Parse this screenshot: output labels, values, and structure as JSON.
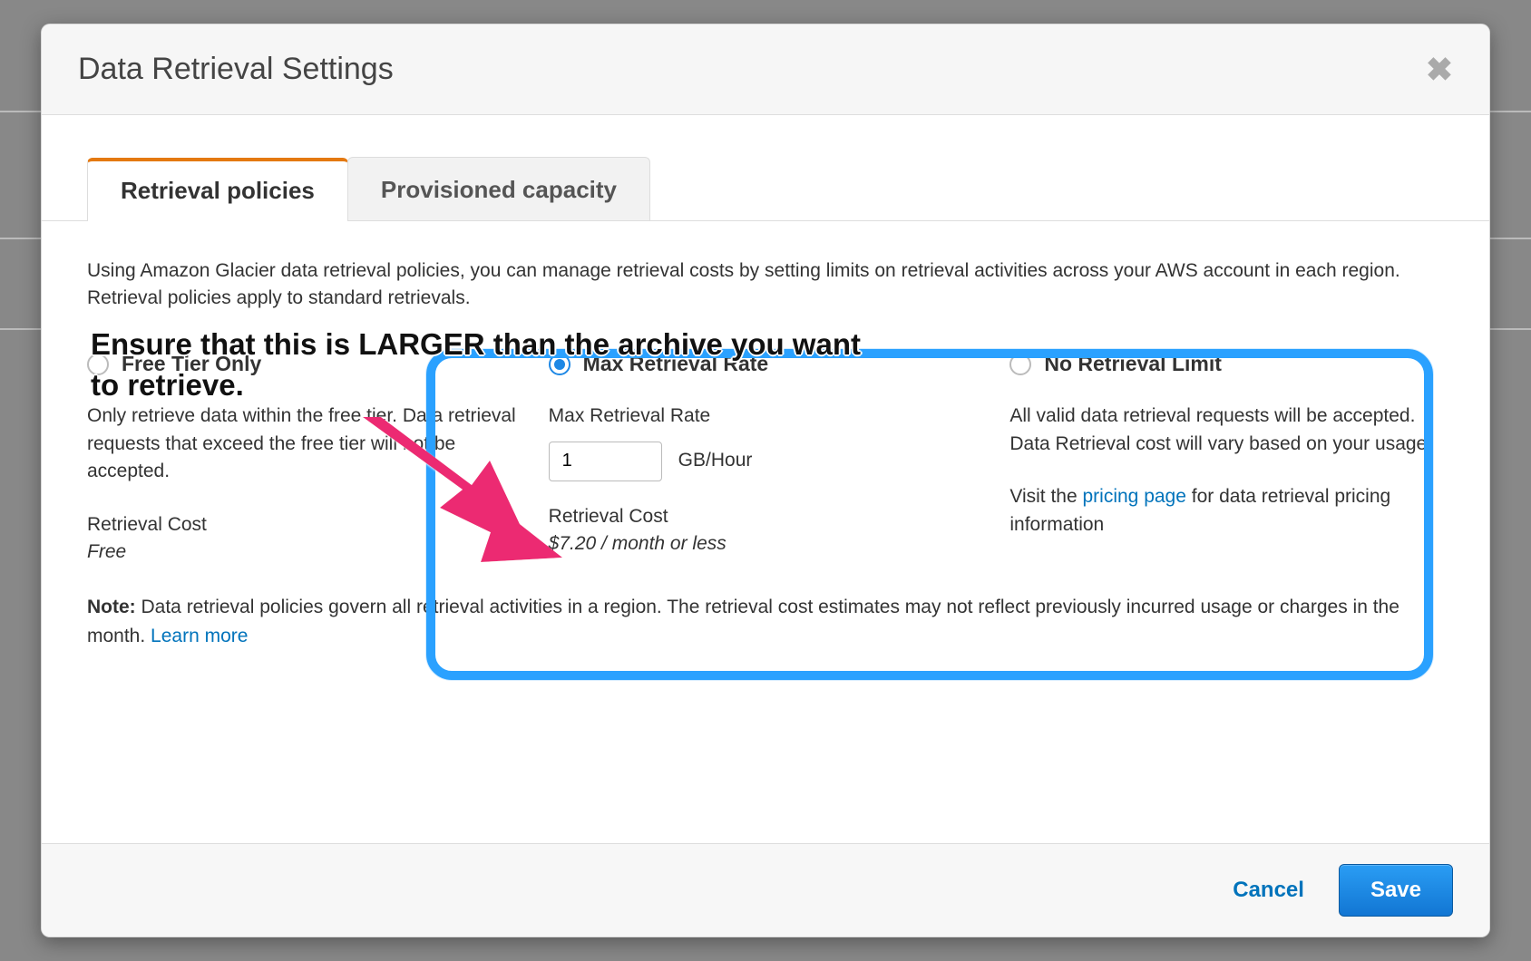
{
  "modal": {
    "title": "Data Retrieval Settings",
    "close_glyph": "✖"
  },
  "tabs": {
    "retrieval_policies": "Retrieval policies",
    "provisioned_capacity": "Provisioned capacity"
  },
  "intro": "Using Amazon Glacier data retrieval policies, you can manage retrieval costs by setting limits on retrieval activities across your AWS account in each region. Retrieval policies apply to standard retrievals.",
  "options": {
    "free_tier": {
      "label": "Free Tier Only",
      "desc": "Only retrieve data within the free tier. Data retrieval requests that exceed the free tier will not be accepted.",
      "cost_label": "Retrieval Cost",
      "cost_value": "Free"
    },
    "max_rate": {
      "label": "Max Retrieval Rate",
      "sub_label": "Max Retrieval Rate",
      "rate_value": "1",
      "unit": "GB/Hour",
      "cost_label": "Retrieval Cost",
      "cost_value": "$7.20 / month or less"
    },
    "no_limit": {
      "label": "No Retrieval Limit",
      "desc": "All valid data retrieval requests will be accepted. Data Retrieval cost will vary based on your usage.",
      "visit_prefix": "Visit the ",
      "pricing_link": "pricing page",
      "visit_suffix": " for data retrieval pricing information"
    }
  },
  "note": {
    "prefix": "Note: ",
    "body": "Data retrieval policies govern all retrieval activities in a region. The retrieval cost estimates may not reflect previously incurred usage or charges in the month. ",
    "learn_more": "Learn more"
  },
  "footer": {
    "cancel": "Cancel",
    "save": "Save"
  },
  "annotation": {
    "text": "Ensure that this is LARGER than the archive you want to retrieve."
  },
  "colors": {
    "accent_orange": "#e47911",
    "link_blue": "#0073bb",
    "radio_blue": "#1e88e5",
    "highlight_blue": "#2aa1ff",
    "arrow_pink": "#ec2a72"
  }
}
